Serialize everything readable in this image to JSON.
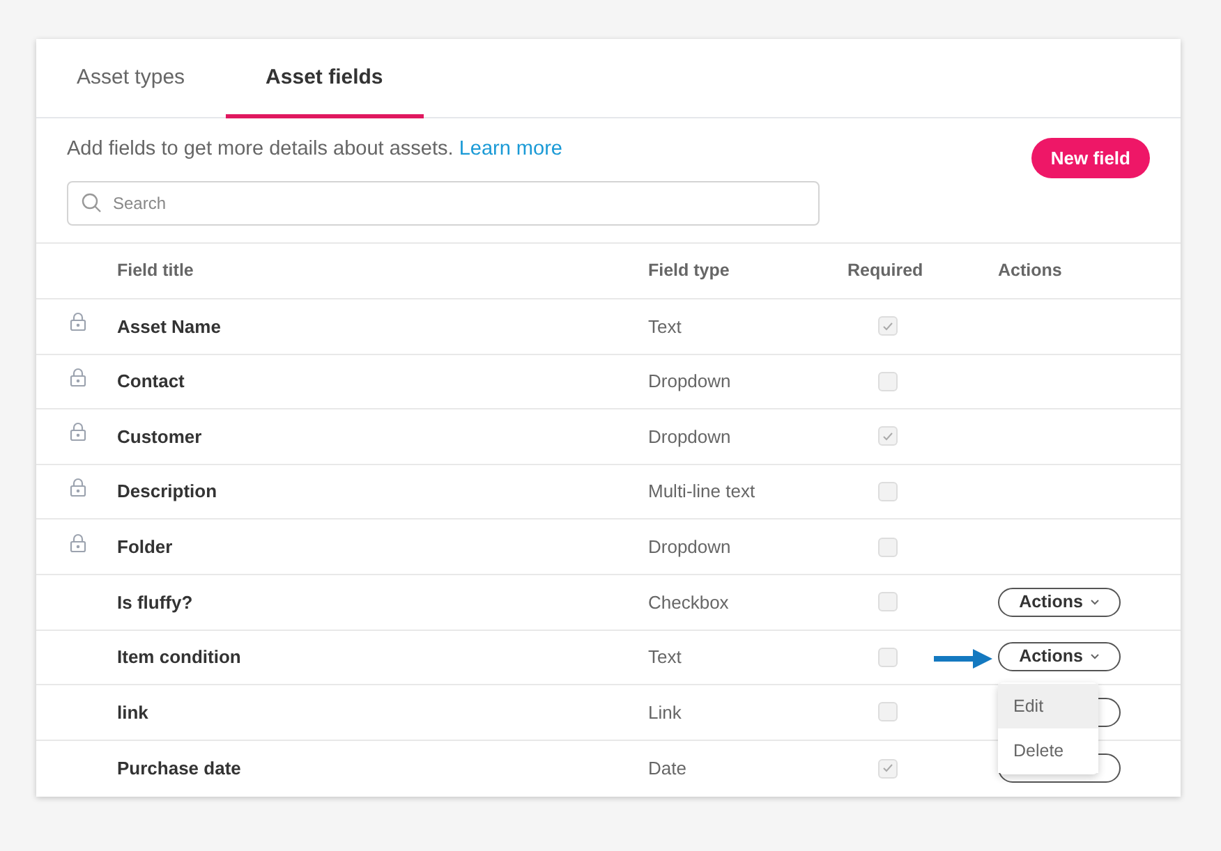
{
  "tabs": [
    {
      "label": "Asset types",
      "selected": false
    },
    {
      "label": "Asset fields",
      "selected": true
    }
  ],
  "intro": {
    "text": "Add fields to get more details about assets.",
    "link": "Learn more"
  },
  "new_button": "New field",
  "search": {
    "placeholder": "Search"
  },
  "table": {
    "columns": [
      "Field title",
      "Field type",
      "Required",
      "Actions"
    ],
    "rows": [
      {
        "title": "Asset Name",
        "type": "Text",
        "locked": true,
        "required": true
      },
      {
        "title": "Contact",
        "type": "Dropdown",
        "locked": true,
        "required": false
      },
      {
        "title": "Customer",
        "type": "Dropdown",
        "locked": true,
        "required": true
      },
      {
        "title": "Description",
        "type": "Multi-line text",
        "locked": true,
        "required": false
      },
      {
        "title": "Folder",
        "type": "Dropdown",
        "locked": true,
        "required": false
      },
      {
        "title": "Is fluffy?",
        "type": "Checkbox",
        "locked": false,
        "required": false,
        "actions": "Actions"
      },
      {
        "title": "Item condition",
        "type": "Text",
        "locked": false,
        "required": false,
        "actions": "Actions",
        "pointer_arrow": true
      },
      {
        "title": "link",
        "type": "Link",
        "locked": false,
        "required": false,
        "actions_covered": true
      },
      {
        "title": "Purchase date",
        "type": "Date",
        "locked": false,
        "required": true,
        "actions_covered": true
      }
    ]
  },
  "menu": {
    "open": true,
    "items": [
      {
        "label": "Edit",
        "selected": true
      },
      {
        "label": "Delete",
        "selected": false
      }
    ]
  }
}
